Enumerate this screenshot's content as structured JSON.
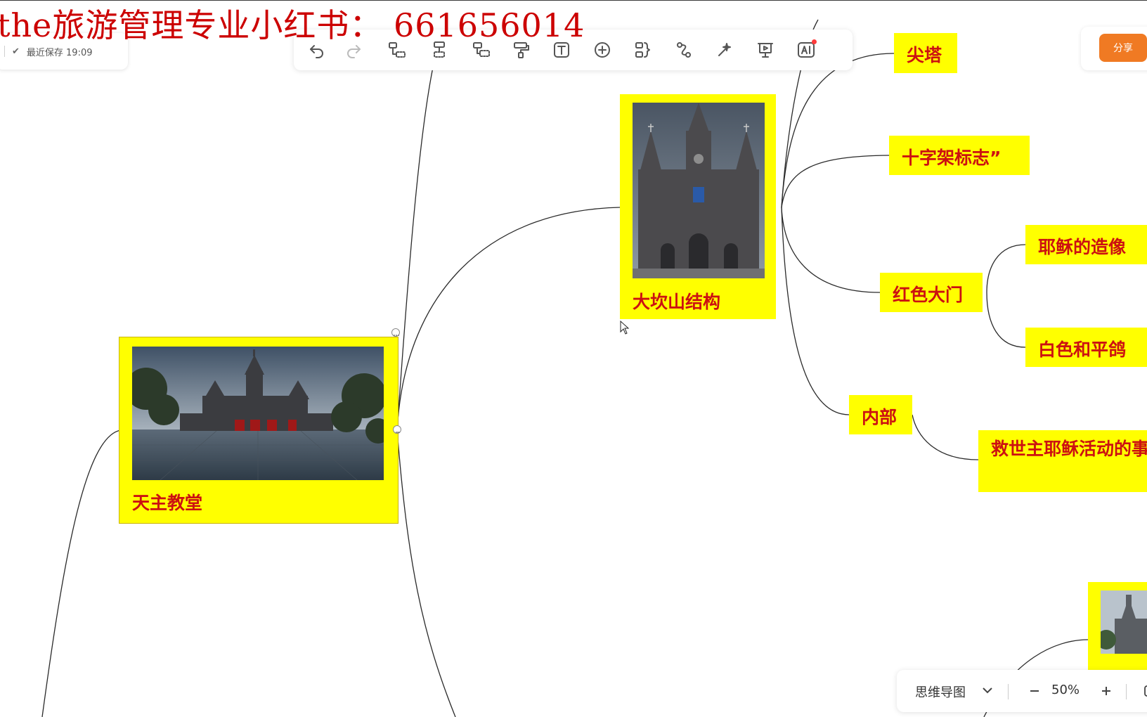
{
  "watermark": "the旅游管理专业小红书：  661656014",
  "status": {
    "save_label": "最近保存 19:09"
  },
  "toolbar": {
    "buttons": [
      {
        "icon": "undo-icon"
      },
      {
        "icon": "redo-icon"
      },
      {
        "icon": "add-child-topic-icon"
      },
      {
        "icon": "add-sibling-topic-icon"
      },
      {
        "icon": "add-parent-topic-icon"
      },
      {
        "icon": "format-painter-icon"
      },
      {
        "icon": "text-icon"
      },
      {
        "icon": "insert-plus-icon"
      },
      {
        "icon": "summary-icon"
      },
      {
        "icon": "relation-line-icon"
      },
      {
        "icon": "magic-style-icon"
      },
      {
        "icon": "presentation-icon"
      },
      {
        "icon": "ai-icon"
      }
    ]
  },
  "share": {
    "label": "分享"
  },
  "nodes": {
    "catholic_church": "天主教堂",
    "dakanshan_structure": "大坎山结构",
    "spire": "尖塔",
    "cross_sign": "十字架标志”",
    "red_gate": "红色大门",
    "jesus_statue": "耶稣的造像",
    "white_dove": "白色和平鸽",
    "interior": "内部",
    "savior_jesus": "救世主耶稣活动的事迹"
  },
  "bottom": {
    "mode_label": "思维导图",
    "zoom_label": "50%"
  },
  "colors": {
    "node_fill": "#ffff00",
    "node_text": "#cc1111",
    "share_button": "#f07a23",
    "watermark": "#cc0000"
  }
}
